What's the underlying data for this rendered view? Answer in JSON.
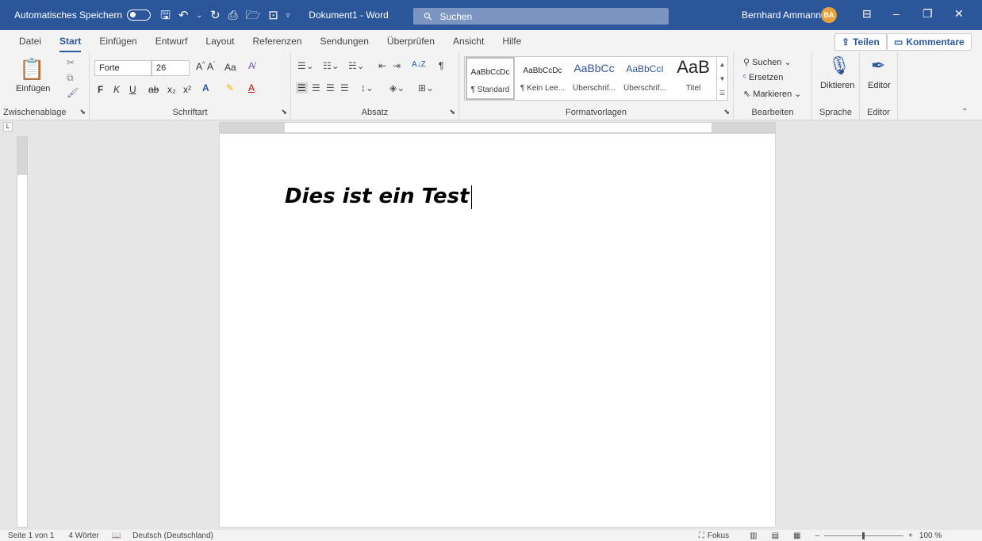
{
  "titlebar": {
    "autosave_label": "Automatisches Speichern",
    "document_title": "Dokument1 - Word",
    "search_placeholder": "Suchen",
    "user_name": "Bernhard Ammann",
    "user_initials": "BA"
  },
  "menu": {
    "tabs": [
      "Datei",
      "Start",
      "Einfügen",
      "Entwurf",
      "Layout",
      "Referenzen",
      "Sendungen",
      "Überprüfen",
      "Ansicht",
      "Hilfe"
    ],
    "active_tab": "Start",
    "share_label": "Teilen",
    "comments_label": "Kommentare"
  },
  "ribbon": {
    "clipboard": {
      "paste_label": "Einfügen",
      "group_label": "Zwischenablage"
    },
    "font": {
      "font_name": "Forte",
      "font_size": "26",
      "bold": "F",
      "italic": "K",
      "underline": "U",
      "strike": "ab",
      "subscript": "x₂",
      "superscript": "x²",
      "case": "Aa",
      "grow": "A",
      "group_label": "Schriftart"
    },
    "paragraph": {
      "sort": "A↓Z",
      "pilcrow": "¶",
      "group_label": "Absatz"
    },
    "styles": {
      "items": [
        {
          "preview": "AaBbCcDc",
          "name": "¶ Standard"
        },
        {
          "preview": "AaBbCcDc",
          "name": "¶ Kein Lee..."
        },
        {
          "preview": "AaBbCc",
          "name": "Überschrif..."
        },
        {
          "preview": "AaBbCcI",
          "name": "Überschrif..."
        },
        {
          "preview": "AaB",
          "name": "Titel"
        }
      ],
      "group_label": "Formatvorlagen"
    },
    "editing": {
      "find": "Suchen",
      "replace": "Ersetzen",
      "select": "Markieren",
      "group_label": "Bearbeiten"
    },
    "voice": {
      "dictate": "Diktieren",
      "group_label": "Sprache"
    },
    "editor": {
      "editor_label": "Editor",
      "group_label": "Editor"
    }
  },
  "document": {
    "body_text": "Dies ist ein Test"
  },
  "statusbar": {
    "page": "Seite 1 von 1",
    "words": "4 Wörter",
    "language": "Deutsch (Deutschland)",
    "focus": "Fokus",
    "zoom": "100 %"
  },
  "colors": {
    "titlebar": "#2b579a",
    "avatar": "#e8a23e"
  }
}
